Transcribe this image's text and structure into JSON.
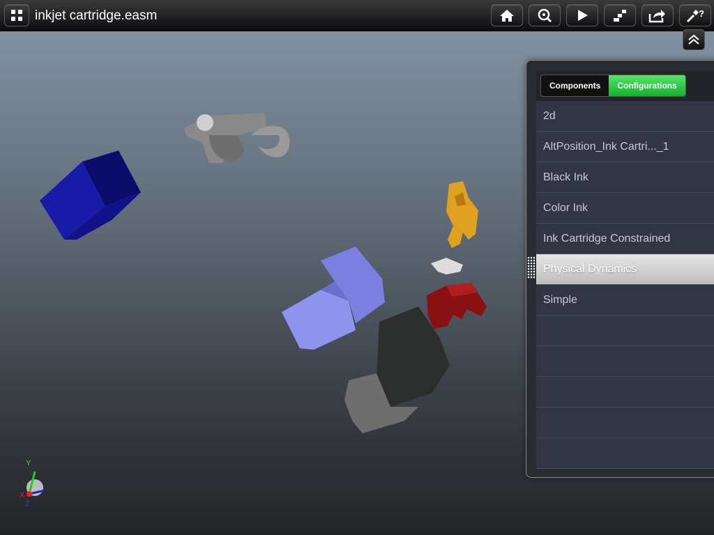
{
  "header": {
    "title": "inkjet cartridge.easm",
    "menu_icon": "grid-icon",
    "toolbar": [
      "home-icon",
      "zoom-icon",
      "play-icon",
      "explode-icon",
      "share-icon",
      "help-icon"
    ]
  },
  "panel": {
    "collapse_icon": "double-chevron-up-icon",
    "tabs": [
      {
        "label": "Components",
        "active": false
      },
      {
        "label": "Configurations",
        "active": true
      }
    ],
    "configurations": [
      {
        "label": "2d"
      },
      {
        "label": "AltPosition_Ink Cartri..._1"
      },
      {
        "label": "Black Ink"
      },
      {
        "label": "Color Ink"
      },
      {
        "label": "Ink Cartridge Constrained"
      },
      {
        "label": "Physical Dynamics",
        "selected": true
      },
      {
        "label": "Simple"
      },
      {
        "label": ""
      },
      {
        "label": ""
      },
      {
        "label": ""
      },
      {
        "label": ""
      },
      {
        "label": ""
      }
    ]
  },
  "triad": {
    "x_label": "X",
    "y_label": "Y",
    "z_label": "Z"
  },
  "colors": {
    "accent_green": "#14b12d",
    "cube_blue": "#15158f",
    "violet_part": "#8f95ef",
    "orange_part": "#e0a020",
    "red_part": "#8a1111",
    "gray_part": "#7a7a7a",
    "dark_part": "#2b2e2c"
  }
}
